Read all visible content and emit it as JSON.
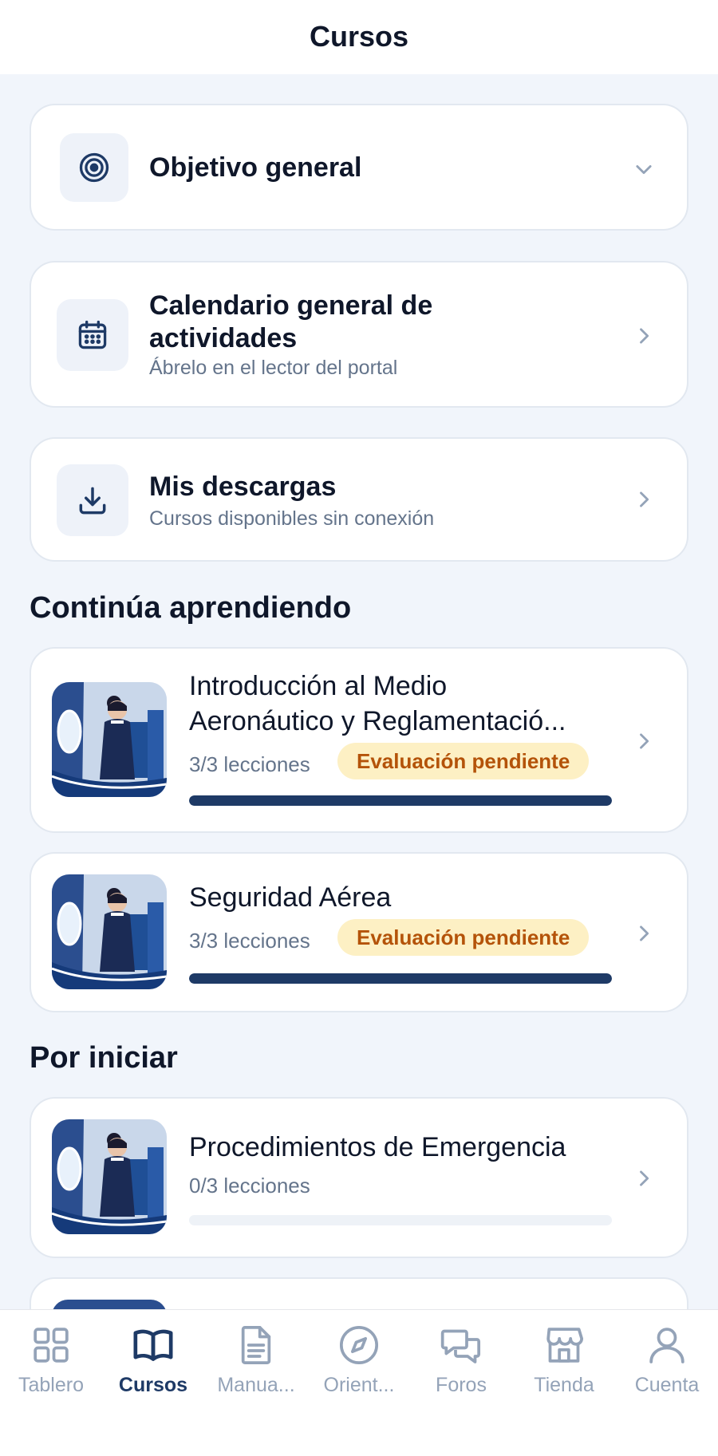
{
  "header": {
    "title": "Cursos"
  },
  "cards": {
    "objective": {
      "title": "Objetivo general",
      "icon": "target-icon"
    },
    "calendar": {
      "title_line1": "Calendario general de",
      "title_line2": "actividades",
      "subtitle": "Ábrelo en el lector del portal",
      "icon": "calendar-icon"
    },
    "downloads": {
      "title": "Mis descargas",
      "subtitle": "Cursos disponibles sin conexión",
      "icon": "download-icon"
    }
  },
  "sections": {
    "continue": {
      "title": "Continúa aprendiendo",
      "courses": [
        {
          "title_line1": "Introducción al Medio",
          "title_line2": "Aeronáutico y Reglamentació...",
          "lessons": "3/3 lecciones",
          "badge": "Evaluación pendiente",
          "progress": 1.0
        },
        {
          "title_line1": "Seguridad Aérea",
          "lessons": "3/3 lecciones",
          "badge": "Evaluación pendiente",
          "progress": 1.0
        }
      ]
    },
    "not_started": {
      "title": "Por iniciar",
      "courses": [
        {
          "title_line1": "Procedimientos de Emergencia",
          "lessons": "0/3 lecciones",
          "progress": 0.0
        }
      ]
    }
  },
  "tabbar": {
    "active": "Cursos",
    "tabs": [
      {
        "label": "Tablero",
        "icon": "grid-icon"
      },
      {
        "label": "Cursos",
        "icon": "book-open-icon"
      },
      {
        "label": "Manua...",
        "icon": "document-icon"
      },
      {
        "label": "Orient...",
        "icon": "compass-icon"
      },
      {
        "label": "Foros",
        "icon": "chat-bubbles-icon"
      },
      {
        "label": "Tienda",
        "icon": "store-icon"
      },
      {
        "label": "Cuenta",
        "icon": "user-icon"
      }
    ]
  },
  "colors": {
    "accent": "#1e3a66",
    "badge_bg": "#fdf0c4",
    "badge_text": "#b45309",
    "background": "#f1f5fb"
  }
}
